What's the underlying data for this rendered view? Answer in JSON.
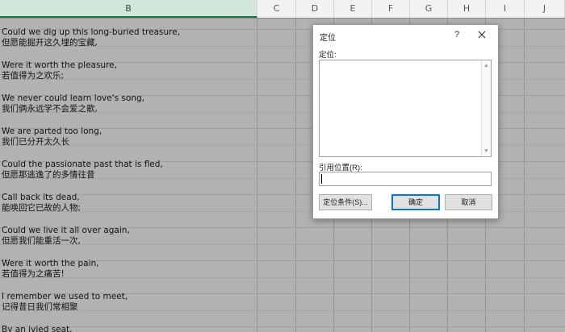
{
  "columns": [
    "B",
    "C",
    "D",
    "E",
    "F",
    "G",
    "H",
    "I",
    "J"
  ],
  "selected_column": "B",
  "cells": [
    {
      "en": "Could we dig up this long-buried treasure,",
      "zh": "但愿能掘开这久埋的宝藏,"
    },
    {
      "en": "Were it worth the pleasure,",
      "zh": "若值得为之欢乐;"
    },
    {
      "en": "We never could learn love's song,",
      "zh": "我们俩永远学不会爱之歌,"
    },
    {
      "en": "We are parted too long,",
      "zh": "我们已分开太久长"
    },
    {
      "en": "Could the passionate past that is fled,",
      "zh": "但愿那逃逸了的多情往昔"
    },
    {
      "en": "Call back its dead,",
      "zh": "能唤回它已故的人物;"
    },
    {
      "en": "Could we live it all over again,",
      "zh": "但愿我们能重活一次,"
    },
    {
      "en": "Were it worth the pain,",
      "zh": "若值得为之痛苦!"
    },
    {
      "en": "I remember we used to meet,",
      "zh": "记得昔日我们常相聚"
    },
    {
      "en": "By an ivied seat,",
      "zh": ""
    }
  ],
  "dialog": {
    "title": "定位",
    "help": "?",
    "goto_label": "定位:",
    "goto_items": [],
    "reference_label": "引用位置(R):",
    "reference_value": "",
    "special_button": "定位条件(S)...",
    "ok_button": "确定",
    "cancel_button": "取消"
  },
  "colors": {
    "header_bg": "#f2f2f2",
    "selected_header_bg": "#d2e7da",
    "accent": "#217346",
    "dialog_focus": "#0078d7"
  }
}
